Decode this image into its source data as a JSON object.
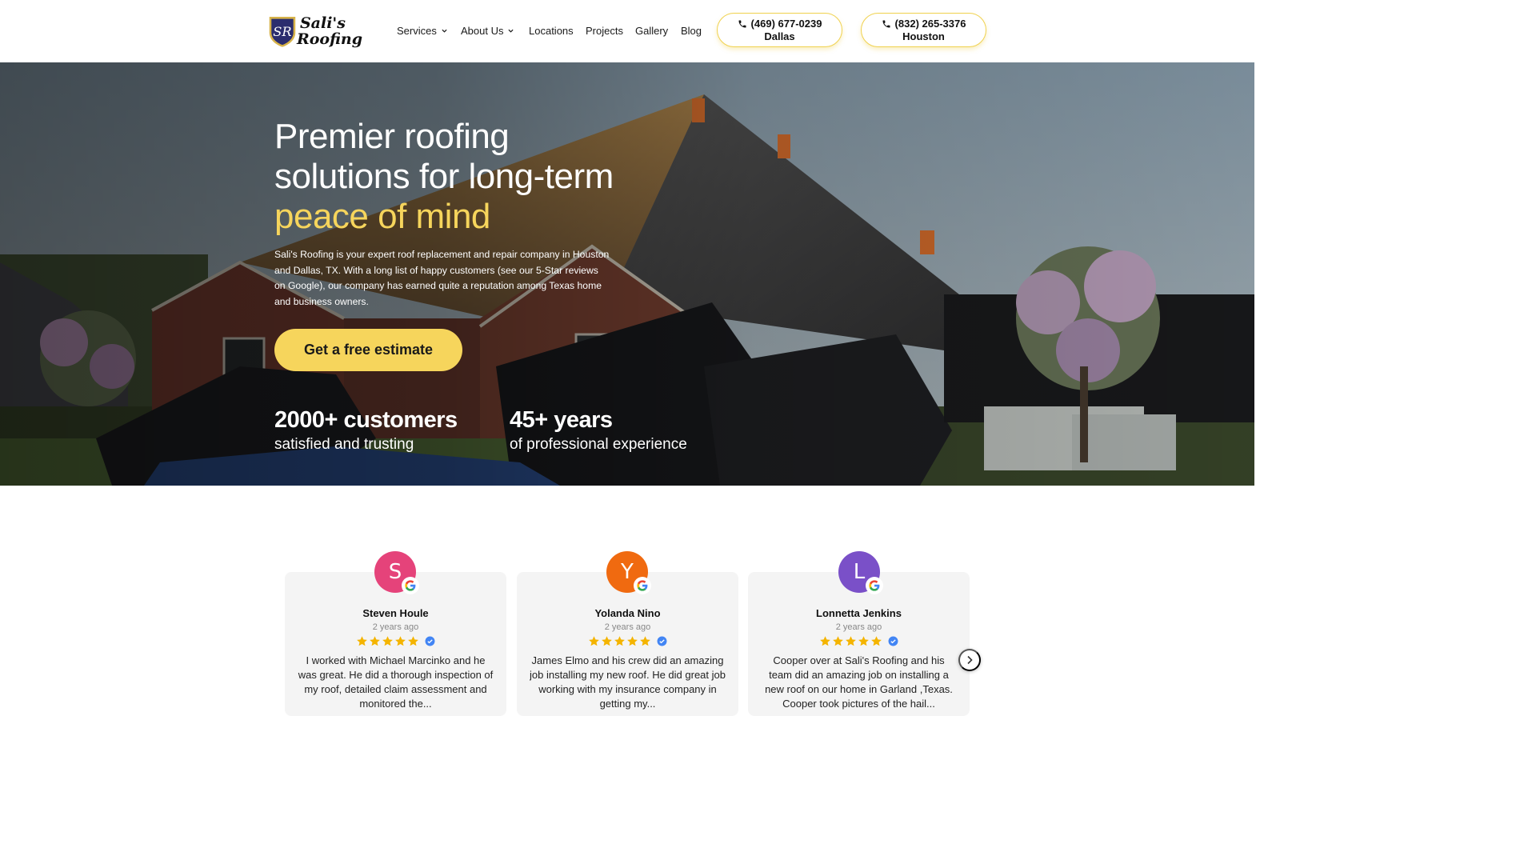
{
  "brand": {
    "name_line1": "Sali's",
    "name_line2": "Roofing",
    "monogram": "SR"
  },
  "nav": {
    "items": [
      {
        "label": "Services",
        "has_dropdown": true
      },
      {
        "label": "About Us",
        "has_dropdown": true
      },
      {
        "label": "Locations",
        "has_dropdown": false
      },
      {
        "label": "Projects",
        "has_dropdown": false
      },
      {
        "label": "Gallery",
        "has_dropdown": false
      },
      {
        "label": "Blog",
        "has_dropdown": false
      }
    ]
  },
  "phones": [
    {
      "number": "(469) 677-0239",
      "city": "Dallas"
    },
    {
      "number": "(832) 265-3376",
      "city": "Houston"
    }
  ],
  "hero": {
    "title_part1": "Premier roofing solutions for long-term ",
    "title_accent": "peace of mind",
    "description": "Sali's Roofing is your expert roof replacement and repair company in Houston and Dallas, TX. With a long list of happy customers (see our 5-Star reviews on Google), our company has earned quite a reputation among Texas home and business owners.",
    "cta_label": "Get a free estimate",
    "stats": [
      {
        "value": "2000+ customers",
        "label": "satisfied and trusting"
      },
      {
        "value": "45+ years",
        "label": "of professional experience"
      }
    ]
  },
  "reviews": [
    {
      "initial": "S",
      "name": "Steven Houle",
      "date": "2 years ago",
      "rating": 5,
      "text": "I worked with Michael Marcinko and he was great. He did a thorough inspection of my roof, detailed claim assessment and monitored the..."
    },
    {
      "initial": "Y",
      "name": "Yolanda Nino",
      "date": "2 years ago",
      "rating": 5,
      "text": "James Elmo and his crew did an amazing job installing my new roof. He did great job working with my insurance company in getting my..."
    },
    {
      "initial": "L",
      "name": "Lonnetta Jenkins",
      "date": "2 years ago",
      "rating": 5,
      "text": "Cooper over at Sali's Roofing and his team did an amazing job on installing a new roof on our home in Garland ,Texas. Cooper took pictures of the hail..."
    }
  ],
  "colors": {
    "accent_yellow": "#f6d55c",
    "brand_navy": "#2b2d6e",
    "brand_gold": "#d7b34a",
    "avatar_colors": [
      "#e5437a",
      "#f06a10",
      "#7a50c8"
    ],
    "star": "#f4b400",
    "verified": "#4285f4"
  },
  "icons": {
    "phone": "phone-icon",
    "dropdown": "chevron-down-icon",
    "review_source": "google-g-icon",
    "verified": "verified-badge-icon",
    "carousel_next": "chevron-right-icon"
  }
}
